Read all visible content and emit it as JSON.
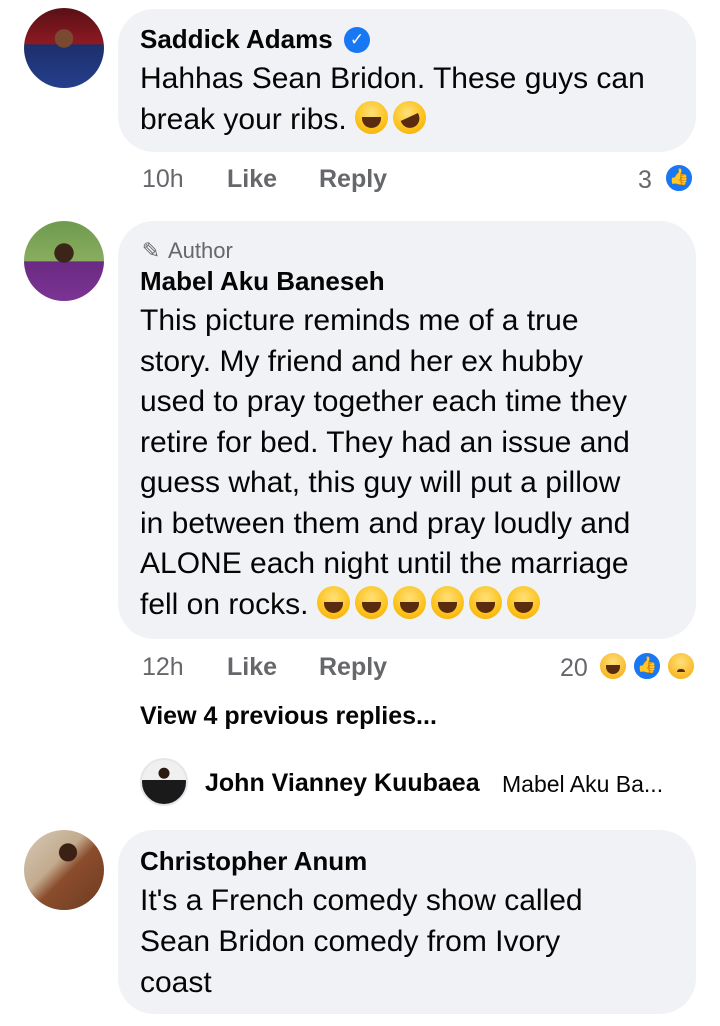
{
  "comments": [
    {
      "author": "Saddick Adams",
      "verified": true,
      "lines": [
        "Hahhas Sean Bridon. These guys can",
        "break your ribs."
      ],
      "time": "10h",
      "like_label": "Like",
      "reply_label": "Reply",
      "reaction_count": "3",
      "reactions": [
        "like-icon"
      ]
    },
    {
      "badge": "Author",
      "author": "Mabel Aku Baneseh",
      "lines": [
        "This picture reminds me of a true",
        "story. My friend and her ex hubby",
        "used to pray together each time they",
        "retire for bed. They had an issue and",
        "guess what, this guy will put a pillow",
        "in between them and pray loudly and",
        "ALONE each night until the marriage",
        "fell on rocks."
      ],
      "time": "12h",
      "like_label": "Like",
      "reply_label": "Reply",
      "reaction_count": "20",
      "reactions": [
        "haha-icon",
        "like-icon",
        "sad-icon"
      ],
      "view_previous": "View 4 previous replies...",
      "latest_reply": {
        "author": "John Vianney Kuubaea",
        "preview": "Mabel Aku Ba..."
      }
    },
    {
      "author": "Christopher Anum",
      "lines": [
        "It's a French comedy show called",
        "Sean Bridon comedy from Ivory",
        "coast"
      ]
    }
  ],
  "colors": {
    "bubble": "#f0f2f5",
    "meta_text": "#65676b",
    "primary_text": "#050505",
    "verified_blue": "#1877f2"
  }
}
